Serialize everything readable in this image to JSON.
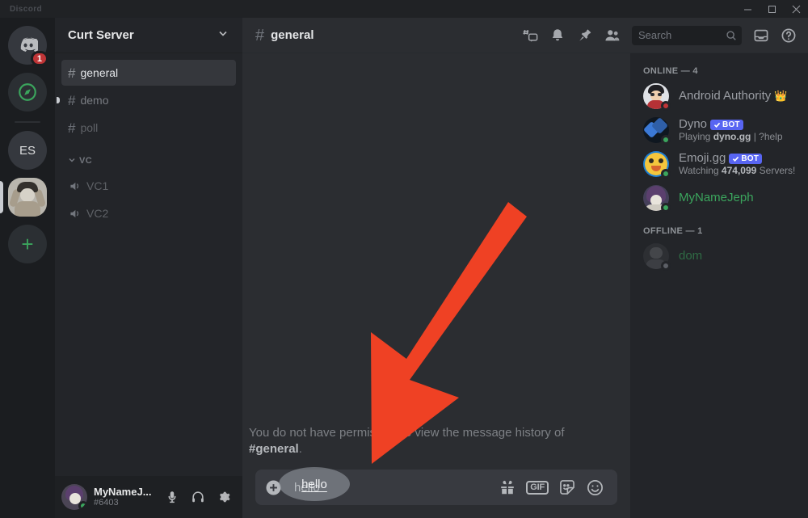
{
  "window": {
    "app_title": "Discord",
    "controls": {
      "minimize": "minimize-icon",
      "maximize": "maximize-icon",
      "close": "close-icon"
    }
  },
  "guild_rail": {
    "items": [
      {
        "name": "Direct Messages",
        "icon": "discord-logo-icon",
        "badge": "1",
        "active": false
      },
      {
        "name": "Explore Public Servers",
        "icon": "compass-icon",
        "badge": "",
        "active": false
      },
      {
        "name": "ES",
        "icon": "text-initials",
        "label": "ES",
        "badge": "",
        "active": false
      },
      {
        "name": "Curt Server",
        "icon": "server-avatar",
        "badge": "",
        "active": true
      },
      {
        "name": "Add a Server",
        "icon": "plus-icon",
        "label": "+",
        "badge": "",
        "active": false
      }
    ]
  },
  "sidebar": {
    "server_name": "Curt Server",
    "server_dropdown_icon": "chevron-down-icon",
    "channels": [
      {
        "label": "general",
        "type": "text",
        "active": true,
        "unread": false,
        "muted": false
      },
      {
        "label": "demo",
        "type": "text",
        "active": false,
        "unread": true,
        "muted": false
      },
      {
        "label": "poll",
        "type": "text",
        "active": false,
        "unread": false,
        "muted": true
      }
    ],
    "category": {
      "label": "VC",
      "collapsed": false
    },
    "voice_channels": [
      {
        "label": "VC1",
        "type": "voice"
      },
      {
        "label": "VC2",
        "type": "voice"
      }
    ],
    "user_panel": {
      "name": "MyNameJ...",
      "tag": "#6403",
      "status": "online",
      "mic_icon": "microphone-icon",
      "headset_icon": "headphones-icon",
      "settings_icon": "gear-icon"
    }
  },
  "header": {
    "hash_icon": "hash-icon",
    "channel": "general",
    "icons": [
      {
        "name": "threads-icon"
      },
      {
        "name": "notifications-bell-icon"
      },
      {
        "name": "pinned-messages-icon"
      },
      {
        "name": "member-list-icon"
      }
    ],
    "search": {
      "placeholder": "Search",
      "icon": "search-icon"
    },
    "inbox_icon": "inbox-icon",
    "help_icon": "help-icon"
  },
  "main": {
    "system_message_prefix": "You do not have permission to view the message history of ",
    "system_message_channel": "#general",
    "system_message_suffix": ".",
    "composer": {
      "value": "hello",
      "add_icon": "plus-circle-icon",
      "gift_icon": "gift-icon",
      "gif_label": "GIF",
      "sticker_icon": "sticker-icon",
      "emoji_icon": "emoji-icon"
    }
  },
  "members": {
    "online_header": "ONLINE — 4",
    "offline_header": "OFFLINE — 1",
    "online": [
      {
        "name": "Android Authority",
        "decoration": "👑",
        "status": "dnd",
        "is_bot": false,
        "bot_label": "",
        "activity": "",
        "activity_prefix": "",
        "activity_bold": "",
        "activity_suffix": "",
        "name_color": "#9a9da3"
      },
      {
        "name": "Dyno",
        "decoration": "",
        "status": "online",
        "is_bot": true,
        "bot_label": "BOT",
        "activity_prefix": "Playing ",
        "activity_bold": "dyno.gg",
        "activity_suffix": " | ?help",
        "name_color": "#9a9da3"
      },
      {
        "name": "Emoji.gg",
        "decoration": "",
        "status": "online",
        "is_bot": true,
        "bot_label": "BOT",
        "activity_prefix": "Watching ",
        "activity_bold": "474,099",
        "activity_suffix": " Servers!",
        "name_color": "#9a9da3"
      },
      {
        "name": "MyNameJeph",
        "decoration": "",
        "status": "online",
        "is_bot": false,
        "bot_label": "",
        "activity_prefix": "",
        "activity_bold": "",
        "activity_suffix": "",
        "name_color": "#3ba55d"
      }
    ],
    "offline": [
      {
        "name": "dom",
        "decoration": "",
        "status": "offline",
        "is_bot": false,
        "bot_label": "",
        "activity_prefix": "",
        "activity_bold": "",
        "activity_suffix": "",
        "name_color": "#2f6b44"
      }
    ]
  },
  "annotation": {
    "arrow_color": "#ef4124",
    "arrow_name": "red-pointer-arrow",
    "highlight_text": "hello"
  },
  "colors": {
    "accent": "#5865f2",
    "online": "#3ba55d",
    "dnd": "#c03537",
    "offline": "#6b6f76",
    "arrow": "#ef4124"
  }
}
